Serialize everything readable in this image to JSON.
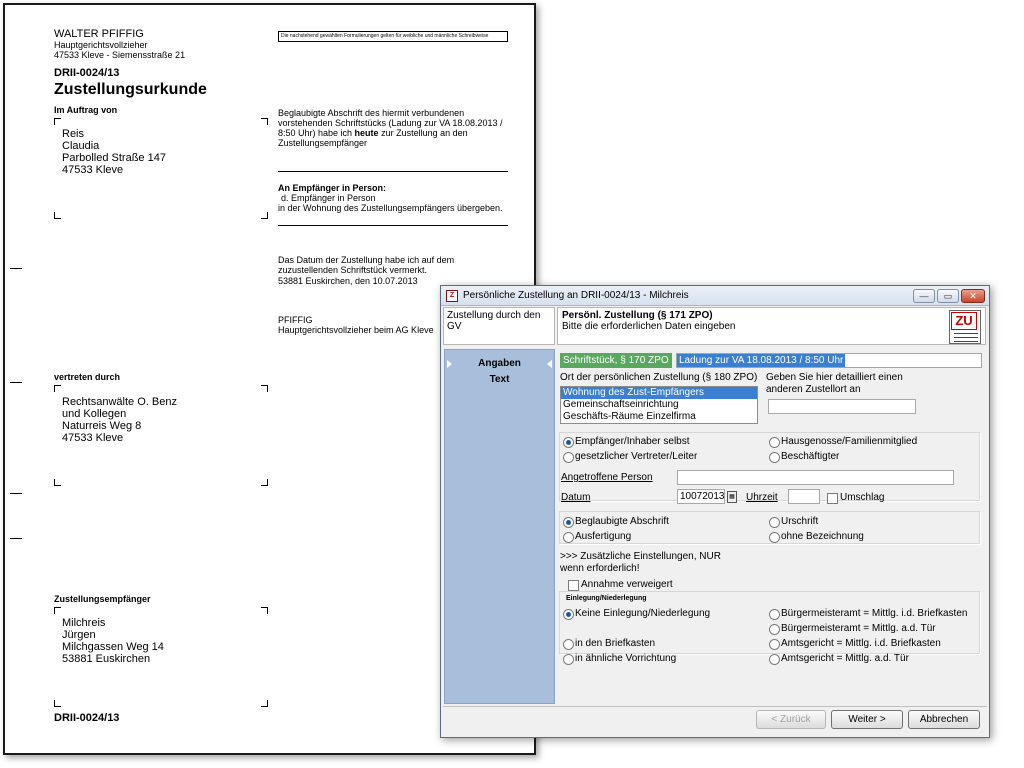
{
  "document": {
    "sender_name": "WALTER PFIFFIG",
    "sender_title": "Hauptgerichtsvollzieher",
    "sender_address": "47533 Kleve - Siemensstraße 21",
    "case_number": "DRII-0024/13",
    "doc_title": "Zustellungsurkunde",
    "im_auftrag_label": "Im Auftrag von",
    "client": [
      "Reis",
      "Claudia",
      "Parbolled Straße 147",
      "47533 Kleve"
    ],
    "notice": "Die nachstehend gewählten Formulierungen gelten für weibliche und männliche Schreibweise",
    "certified_pre": "Beglaubigte Abschrift des hiermit verbundenen vorstehenden Schriftstücks (Ladung zur VA 18.08.2013 / 8:50 Uhr) habe ich ",
    "certified_bold": "heute",
    "certified_post": " zur Zustellung an den Zustellungsempfänger",
    "recipient_heading": "An Empfänger in Person:",
    "recipient_line1": "d. Empfänger in Person",
    "recipient_line2": "in der Wohnung des Zustellungsempfängers übergeben.",
    "date_note": "Das Datum der Zustellung habe ich auf dem zuzustellenden Schriftstück vermerkt.",
    "place_date": "53881 Euskirchen, den 10.07.2013",
    "signer_name": "PFIFFIG",
    "signer_title": "Hauptgerichtsvollzieher beim AG Kleve",
    "vertreten_label": "vertreten durch",
    "representative": [
      "Rechtsanwälte O. Benz",
      "und Kollegen",
      "Naturreis Weg 8",
      "47533 Kleve"
    ],
    "empfaenger_label": "Zustellungsempfänger",
    "recipient": [
      "Milchreis",
      "Jürgen",
      "Milchgassen Weg 14",
      "53881 Euskirchen"
    ],
    "footer_case": "DRII-0024/13"
  },
  "dialog": {
    "title": "Persönliche Zustellung an DRII-0024/13 - Milchreis",
    "win_buttons": {
      "minimize": "—",
      "maximize": "▭",
      "close": "✕"
    },
    "app_icon_text": "Z",
    "header_left": "Zustellung durch den GV",
    "header_title": "Persönl. Zustellung (§ 171 ZPO)",
    "header_subtitle": "Bitte die erforderlichen Daten eingeben",
    "zu_icon_text": "ZU",
    "sidebar": {
      "items": [
        "Angaben",
        "Text"
      ]
    },
    "doc_tag": "Schriftstück, § 170 ZPO",
    "doc_value": "Ladung zur VA 18.08.2013 / 8:50 Uhr",
    "ort_label": "Ort der persönlichen Zustellung (§ 180 ZPO)",
    "ort_options": [
      "Wohnung des Zust-Empfängers",
      "Gemeinschaftseinrichtung",
      "Geschäfts-Räume Einzelfirma"
    ],
    "detail_label": "Geben Sie hier detailliert einen anderen Zustellort an",
    "detail_value": "",
    "person_radios": [
      "Empfänger/Inhaber selbst",
      "Hausgenosse/Familienmitglied",
      "gesetzlicher Vertreter/Leiter",
      "Beschäftigter"
    ],
    "angetroffene_label": "Angetroffene Person",
    "angetroffene_value": "",
    "datum_label": "Datum",
    "datum_value": "10072013",
    "calendar_icon_text": "▦",
    "uhrzeit_label": "Uhrzeit",
    "uhrzeit_value": "",
    "umschlag_label": "Umschlag",
    "copy_radios": [
      "Beglaubigte Abschrift",
      "Urschrift",
      "Ausfertigung",
      "ohne Bezeichnung"
    ],
    "extra_line1": ">>>  Zusätzliche Einstellungen, NUR",
    "extra_line2": "wenn erforderlich!",
    "annahme_label": "Annahme verweigert",
    "einlegung_heading": "Einlegung/Niederlegung",
    "einlegung_radios": [
      "Keine Einlegung/Niederlegung",
      "Bürgermeisteramt = Mittlg. i.d. Briefkasten",
      "Bürgermeisteramt = Mittlg. a.d. Tür",
      "in den Briefkasten",
      "Amtsgericht = Mittlg. i.d. Briefkasten",
      "in ähnliche Vorrichtung",
      "Amtsgericht = Mittlg. a.d. Tür"
    ],
    "buttons": {
      "back": "< Zurück",
      "next": "Weiter >",
      "cancel": "Abbrechen"
    }
  }
}
